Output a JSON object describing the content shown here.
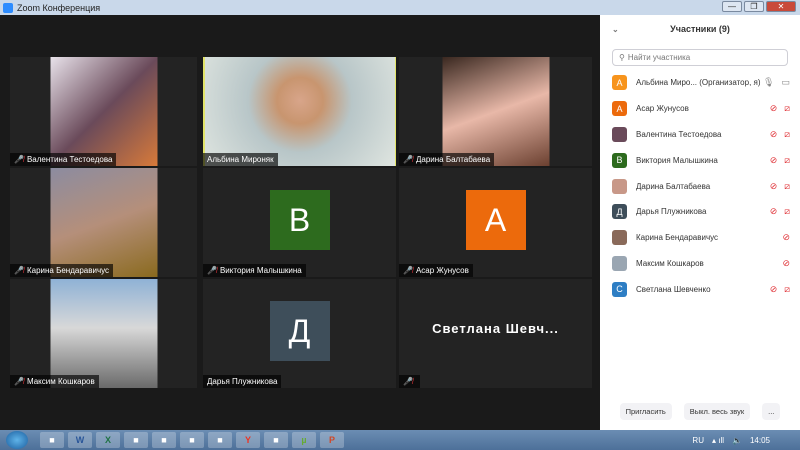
{
  "window": {
    "title": "Zoom Конференция",
    "min": "—",
    "max": "❐",
    "close": "✕"
  },
  "tiles": [
    {
      "name": "Валентина Тестоедова",
      "muted": true,
      "kind": "photo",
      "bg": "linear-gradient(135deg,#e8e2ea,#6a4a5a,#d87a3a)"
    },
    {
      "name": "Альбина Мироняк",
      "muted": false,
      "kind": "photo",
      "active": true,
      "bg": "radial-gradient(circle at 50% 40%,#d8a58a 0,#c8956f 20%,#b8c6c8 45%,#dfe5e0 100%)"
    },
    {
      "name": "Дарина Балтабаева",
      "muted": true,
      "kind": "photo",
      "bg": "linear-gradient(160deg,#3a2820,#e8b8a8 50%,#6b4030)"
    },
    {
      "name": "Карина Бендаравичус",
      "muted": true,
      "kind": "photo",
      "bg": "linear-gradient(160deg,#8c8ca0,#b58f7a 50%,#8a6a1e)"
    },
    {
      "name": "Виктория Малышкина",
      "muted": true,
      "kind": "avatar",
      "letter": "В",
      "color": "#2d6b1e"
    },
    {
      "name": "Асар Жунусов",
      "muted": true,
      "kind": "avatar",
      "letter": "А",
      "color": "#ec6a0c"
    },
    {
      "name": "Максим Кошкаров",
      "muted": true,
      "kind": "photo",
      "bg": "linear-gradient(180deg,#8fb2d6,#d8d8d8 45%,#6a6a6a)"
    },
    {
      "name": "Дарья Плужникова",
      "muted": false,
      "kind": "avatar",
      "letter": "Д",
      "color": "#3e4e5a"
    },
    {
      "name": "",
      "muted": true,
      "kind": "name",
      "bigname": "Светлана Шевч..."
    }
  ],
  "panel": {
    "title": "Участники (9)",
    "search_placeholder": "Найти участника",
    "participants": [
      {
        "name": "Альбина Миро... (Организатор, я)",
        "letter": "А",
        "color": "#f7941d",
        "mic": "on",
        "video": "on"
      },
      {
        "name": "Асар Жунусов",
        "letter": "А",
        "color": "#ec6a0c",
        "mic": "off",
        "video": "off"
      },
      {
        "name": "Валентина Тестоедова",
        "letter": "",
        "color": "#6a4a5a",
        "mic": "off",
        "video": "off"
      },
      {
        "name": "Виктория Малышкина",
        "letter": "В",
        "color": "#2d6b1e",
        "mic": "off",
        "video": "off"
      },
      {
        "name": "Дарина Балтабаева",
        "letter": "",
        "color": "#c89888",
        "mic": "off",
        "video": "off"
      },
      {
        "name": "Дарья Плужникова",
        "letter": "Д",
        "color": "#3e4e5a",
        "mic": "off",
        "video": "off"
      },
      {
        "name": "Карина Бендаравичус",
        "letter": "",
        "color": "#8a6a5a",
        "mic": "off",
        "video": "none"
      },
      {
        "name": "Максим Кошкаров",
        "letter": "",
        "color": "#9aa6b2",
        "mic": "off",
        "video": "none"
      },
      {
        "name": "Светлана Шевченко",
        "letter": "С",
        "color": "#2e7ec4",
        "mic": "off",
        "video": "off"
      }
    ],
    "invite": "Пригласить",
    "mute_all": "Выкл. весь звук",
    "more": "..."
  },
  "taskbar": {
    "apps": [
      "firefox",
      "W",
      "X",
      "shield",
      "zoom",
      "folder",
      "zoom2",
      "Y",
      "chrome",
      "µ",
      "P"
    ],
    "lang": "RU",
    "time": "14:05"
  }
}
